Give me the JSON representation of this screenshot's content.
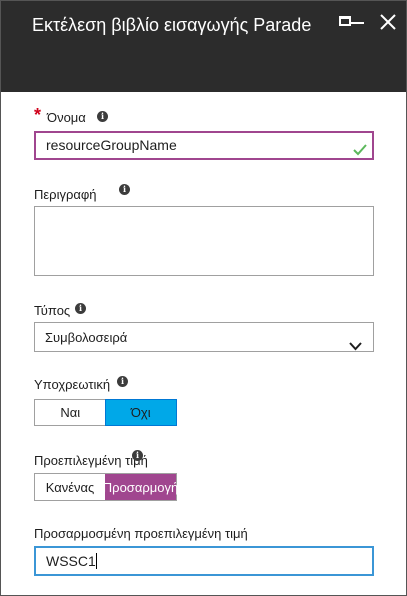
{
  "header": {
    "title": "Εκτέλεση βιβλίο εισαγωγής Parade"
  },
  "icons": {
    "maximize": "maximize-icon",
    "minimize": "minimize-icon",
    "close": "close-icon",
    "info": "info-icon",
    "check": "checkmark-icon",
    "chevron": "chevron-down-icon"
  },
  "colors": {
    "header_bg": "#2c2c2c",
    "required": "#d0021b",
    "valid_border": "#a0468f",
    "valid_check": "#5cb85c",
    "selected_blue": "#00a8e8",
    "selected_purple": "#a0468f",
    "focus_border": "#3b96d6"
  },
  "form": {
    "name": {
      "required_marker": "*",
      "label": "Όνομα",
      "info_glyph": "i",
      "value": "resourceGroupName"
    },
    "description": {
      "label": "Περιγραφή",
      "info_glyph": "i",
      "value": ""
    },
    "type": {
      "label": "Τύπος",
      "info_glyph": "i",
      "selected": "Συμβολοσειρά"
    },
    "mandatory": {
      "label": "Υποχρεωτική",
      "info_glyph": "i",
      "options": [
        "Ναι",
        "Όχι"
      ],
      "selected": "Όχι"
    },
    "default_value": {
      "label": "Προεπιλεγμένη τιμή",
      "info_glyph": "i",
      "options": [
        "Κανένας",
        "Προσαρμογή"
      ],
      "selected": "Προσαρμογή"
    },
    "custom_default": {
      "label": "Προσαρμοσμένη προεπιλεγμένη τιμή",
      "value": "WSSC1"
    }
  }
}
